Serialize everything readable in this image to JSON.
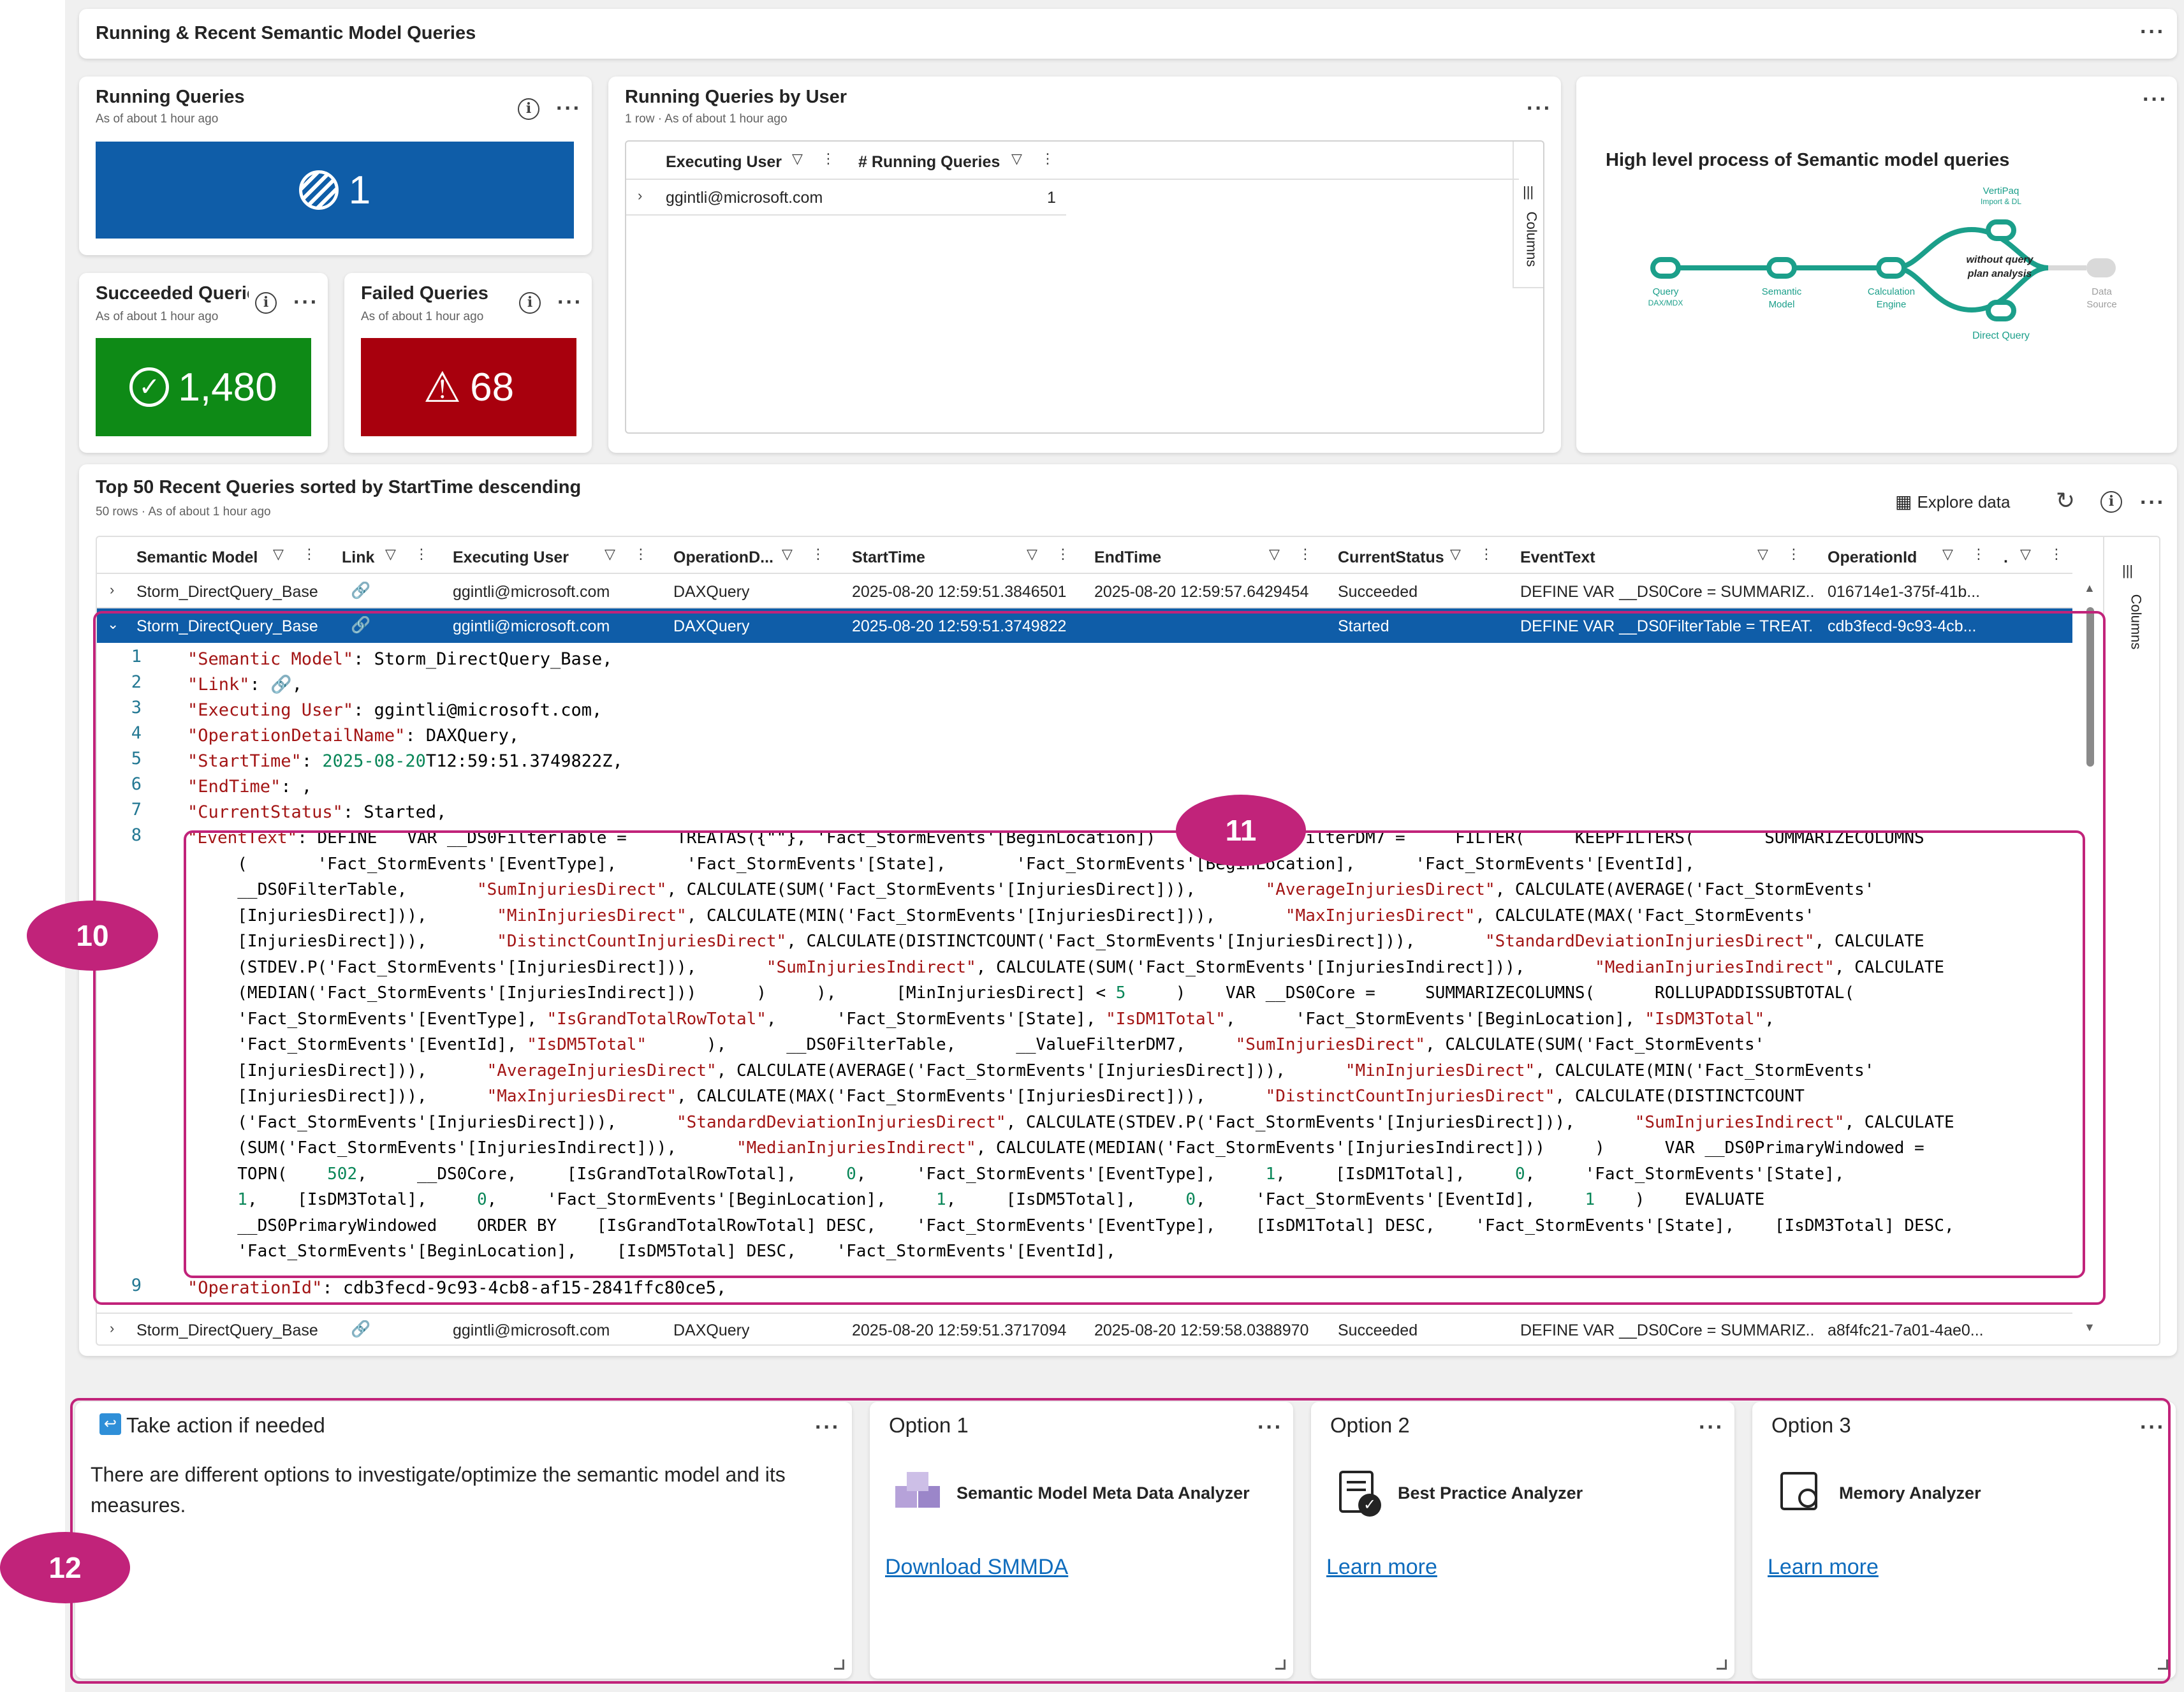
{
  "header": {
    "title": "Running & Recent Semantic Model Queries"
  },
  "running": {
    "title": "Running Queries",
    "asof": "As of about 1 hour ago",
    "value": "1",
    "color": "#0f5da8"
  },
  "succeeded": {
    "title": "Succeeded Querie",
    "asof": "As of about 1 hour ago",
    "value": "1,480",
    "color": "#0e8a16"
  },
  "failed": {
    "title": "Failed Queries",
    "asof": "As of about 1 hour ago",
    "value": "68",
    "color": "#a8000d"
  },
  "by_user": {
    "title": "Running Queries by User",
    "sub": "1 row · As of about 1 hour ago",
    "col1": "Executing User",
    "col2": "# Running Queries",
    "user": "ggintli@microsoft.com",
    "count": "1",
    "columns_label": "Columns"
  },
  "process": {
    "title": "High level process of Semantic model queries",
    "query": "Query",
    "query_sub": "DAX/MDX",
    "semantic1": "Semantic",
    "semantic2": "Model",
    "calc1": "Calculation",
    "calc2": "Engine",
    "vertipaq": "VertiPaq",
    "vertipaq_sub": "Import & DL",
    "without1": "without query",
    "without2": "plan analysis",
    "direct": "Direct Query",
    "ds1": "Data",
    "ds2": "Source"
  },
  "recent": {
    "title": "Top 50 Recent Queries sorted by StartTime descending",
    "sub": "50 rows · As of about 1 hour ago",
    "explore": "Explore data",
    "columns_label": "Columns",
    "headers": [
      "Semantic Model",
      "Link",
      "Executing User",
      "OperationD...",
      "StartTime",
      "EndTime",
      "CurrentStatus",
      "EventText",
      "OperationId",
      "."
    ],
    "rows": [
      {
        "model": "Storm_DirectQuery_Base",
        "user": "ggintli@microsoft.com",
        "op": "DAXQuery",
        "start": "2025-08-20 12:59:51.3846501",
        "end": "2025-08-20 12:59:57.6429454",
        "status": "Succeeded",
        "event": "DEFINE VAR __DS0Core = SUMMARIZ...",
        "opid": "016714e1-375f-41b..."
      },
      {
        "model": "Storm_DirectQuery_Base",
        "user": "ggintli@microsoft.com",
        "op": "DAXQuery",
        "start": "2025-08-20 12:59:51.3749822",
        "end": "",
        "status": "Started",
        "event": "DEFINE VAR __DS0FilterTable = TREAT...",
        "opid": "cdb3fecd-9c93-4cb..."
      },
      {
        "model": "Storm_DirectQuery_Base",
        "user": "ggintli@microsoft.com",
        "op": "DAXQuery",
        "start": "2025-08-20 12:59:51.3717094",
        "end": "2025-08-20 12:59:58.0388970",
        "status": "Succeeded",
        "event": "DEFINE VAR __DS0Core = SUMMARIZ...",
        "opid": "a8f4fc21-7a01-4ae0..."
      }
    ],
    "detail": {
      "l1v": "Storm_DirectQuery_Base,",
      "l3v": "ggintli@microsoft.com,",
      "l4v": "DAXQuery,",
      "l5date": "2025-08-20",
      "l5rest": "T12:59:51.3749822Z,",
      "l7v": "Started,",
      "l9v": "cdb3fecd-9c93-4cb8-af15-2841ffc80ce5,"
    }
  },
  "callouts": {
    "c10": "10",
    "c11": "11",
    "c12": "12"
  },
  "action": {
    "title": "Take action if needed",
    "text": "There are different options to investigate/optimize the semantic model and its measures.",
    "option1": {
      "label": "Option 1",
      "tool": "Semantic Model Meta Data Analyzer",
      "link": "Download SMMDA"
    },
    "option2": {
      "label": "Option 2",
      "tool": "Best Practice Analyzer",
      "link": "Learn more"
    },
    "option3": {
      "label": "Option 3",
      "tool": "Memory Analyzer",
      "link": "Learn more"
    }
  }
}
